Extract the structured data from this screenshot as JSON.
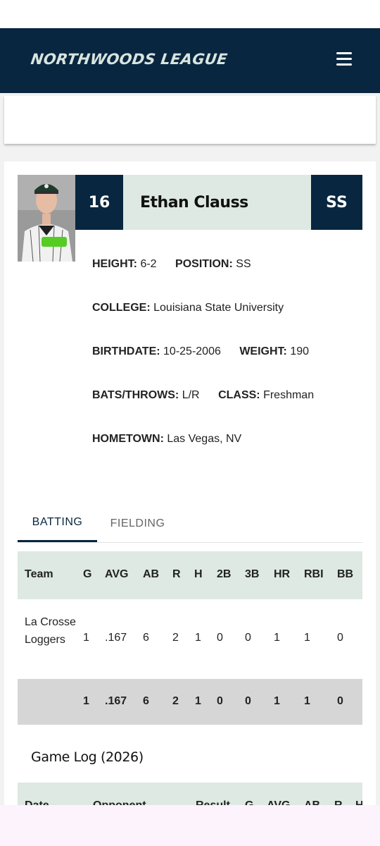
{
  "header": {
    "logo_text": "NORTHWOODS LEAGUE",
    "menu_icon": "hamburger-menu-icon"
  },
  "player": {
    "number": "16",
    "name": "Ethan Clauss",
    "position_abbr": "SS",
    "photo_alt": "player-photo"
  },
  "info": {
    "height_label": "HEIGHT:",
    "height_value": "6-2",
    "position_label": "POSITION:",
    "position_value": "SS",
    "college_label": "COLLEGE:",
    "college_value": "Louisiana State University",
    "birthdate_label": "BIRTHDATE:",
    "birthdate_value": "10-25-2006",
    "weight_label": "WEIGHT:",
    "weight_value": "190",
    "bats_throws_label": "BATS/THROWS:",
    "bats_throws_value": "L/R",
    "class_label": "CLASS:",
    "class_value": "Freshman",
    "hometown_label": "HOMETOWN:",
    "hometown_value": "Las Vegas, NV"
  },
  "tabs": {
    "batting": "BATTING",
    "fielding": "FIELDING"
  },
  "batting_table": {
    "headers": [
      "Team",
      "G",
      "AVG",
      "AB",
      "R",
      "H",
      "2B",
      "3B",
      "HR",
      "RBI",
      "BB"
    ],
    "rows": [
      {
        "team": "La Crosse Loggers",
        "values": [
          "1",
          ".167",
          "6",
          "2",
          "1",
          "0",
          "0",
          "1",
          "1",
          "0"
        ]
      }
    ],
    "totals": [
      "1",
      ".167",
      "6",
      "2",
      "1",
      "0",
      "0",
      "1",
      "1",
      "0"
    ]
  },
  "game_log": {
    "title": "Game Log (2026)",
    "headers": [
      "Date",
      "Opponent",
      "Result",
      "G",
      "AVG",
      "AB",
      "R",
      "H"
    ]
  },
  "colors": {
    "navy": "#08263f",
    "mint": "#dde9e2",
    "total_gray": "#d6d6d6"
  }
}
